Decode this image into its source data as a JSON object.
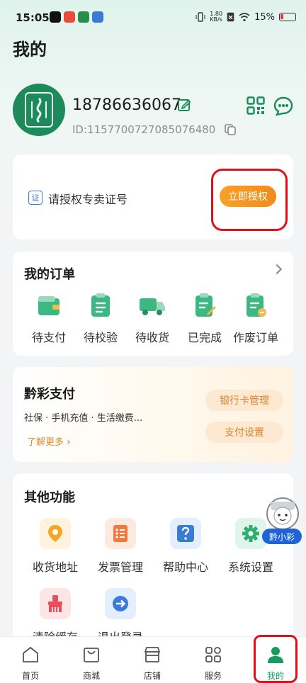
{
  "status_bar": {
    "time": "15:05",
    "net_speed_value": "1.80",
    "net_speed_unit": "KB/s",
    "battery": "15%"
  },
  "page": {
    "title": "我的"
  },
  "profile": {
    "phone": "18786636067",
    "user_id": "ID:1157700727085076480"
  },
  "auth": {
    "badge": "证",
    "label": "请授权专卖证号",
    "button": "立即授权"
  },
  "orders": {
    "title": "我的订单",
    "items": [
      {
        "label": "待支付",
        "icon": "wallet-icon"
      },
      {
        "label": "待校验",
        "icon": "clipboard-check-icon"
      },
      {
        "label": "待收货",
        "icon": "truck-icon"
      },
      {
        "label": "已完成",
        "icon": "clipboard-edit-icon"
      },
      {
        "label": "作废订单",
        "icon": "clipboard-cancel-icon"
      }
    ]
  },
  "pay": {
    "title": "黔彩支付",
    "subtitle": "社保 · 手机充值 · 生活缴费...",
    "learn_more": "了解更多",
    "bank_card_button": "银行卡管理",
    "settings_button": "支付设置"
  },
  "other": {
    "title": "其他功能",
    "items": [
      {
        "label": "收货地址",
        "icon": "location-pin-icon"
      },
      {
        "label": "发票管理",
        "icon": "invoice-icon"
      },
      {
        "label": "帮助中心",
        "icon": "help-icon"
      },
      {
        "label": "系统设置",
        "icon": "gear-icon"
      },
      {
        "label": "清除缓存",
        "icon": "brush-icon"
      },
      {
        "label": "退出登录",
        "icon": "logout-arrow-icon"
      }
    ]
  },
  "mascot": {
    "label": "黔小彩"
  },
  "nav": {
    "items": [
      {
        "label": "首页",
        "icon": "home-icon"
      },
      {
        "label": "商城",
        "icon": "shopping-bag-icon"
      },
      {
        "label": "店铺",
        "icon": "store-icon"
      },
      {
        "label": "服务",
        "icon": "grid-icon"
      },
      {
        "label": "我的",
        "icon": "person-icon"
      }
    ],
    "active_color": "#1a9a5e"
  },
  "colors": {
    "brand_green": "#1d8a5b",
    "accent_orange": "#f28a1a",
    "highlight_red": "#e0101a"
  }
}
